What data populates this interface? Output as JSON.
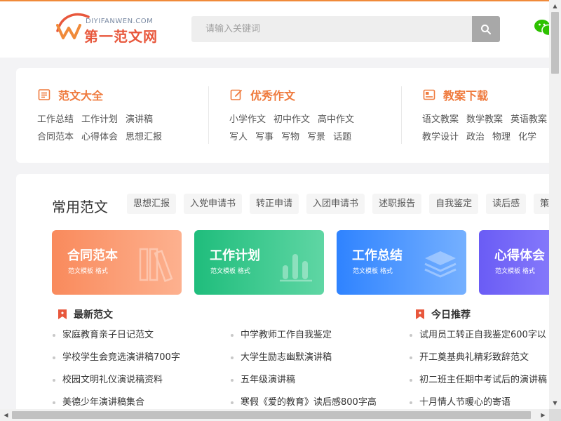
{
  "header": {
    "logo_sub": "DIYIFANWEN.COM",
    "logo_main": "第一范文网",
    "search_placeholder": "请输入关键词",
    "brand_color": "#e8573c",
    "accent_color": "#f08a3a"
  },
  "categories": [
    {
      "title": "范文大全",
      "icon": "document-list-icon",
      "row1": [
        "工作总结",
        "工作计划",
        "演讲稿"
      ],
      "row2": [
        "合同范本",
        "心得体会",
        "思想汇报"
      ]
    },
    {
      "title": "优秀作文",
      "icon": "edit-icon",
      "row1": [
        "小学作文",
        "初中作文",
        "高中作文"
      ],
      "row2": [
        "写人",
        "写事",
        "写物",
        "写景",
        "话题"
      ]
    },
    {
      "title": "教案下载",
      "icon": "book-icon",
      "row1": [
        "语文教案",
        "数学教案",
        "英语教案"
      ],
      "row2": [
        "教学设计",
        "政治",
        "物理",
        "化学"
      ]
    }
  ],
  "common": {
    "title": "常用范文",
    "chips": [
      "思想汇报",
      "入党申请书",
      "转正申请",
      "入团申请书",
      "述职报告",
      "自我鉴定",
      "读后感",
      "策划"
    ]
  },
  "cards": [
    {
      "title": "合同范本",
      "sub": "范文模板 格式",
      "icon": "books-icon",
      "color": "#f98a5c"
    },
    {
      "title": "工作计划",
      "sub": "范文模板 格式",
      "icon": "bar-chart-icon",
      "color": "#1fbd7c"
    },
    {
      "title": "工作总结",
      "sub": "范文模板 格式",
      "icon": "stack-icon",
      "color": "#2f83ff"
    },
    {
      "title": "心得体会",
      "sub": "范文模板 格式",
      "icon": "doc-icon",
      "color": "#6a5cf5"
    }
  ],
  "latest": {
    "title": "最新范文",
    "col1": [
      "家庭教育亲子日记范文",
      "学校学生会竞选演讲稿700字",
      "校园文明礼仪演说稿资料",
      "美德少年演讲稿集合"
    ],
    "col2": [
      "中学教师工作自我鉴定",
      "大学生励志幽默演讲稿",
      "五年级演讲稿",
      "寒假《爱的教育》读后感800字高"
    ]
  },
  "recommend": {
    "title": "今日推荐",
    "items": [
      "试用员工转正自我鉴定600字以",
      "开工奠基典礼精彩致辞范文",
      "初二班主任期中考试后的演讲稿",
      "十月情人节暖心的寄语"
    ]
  }
}
